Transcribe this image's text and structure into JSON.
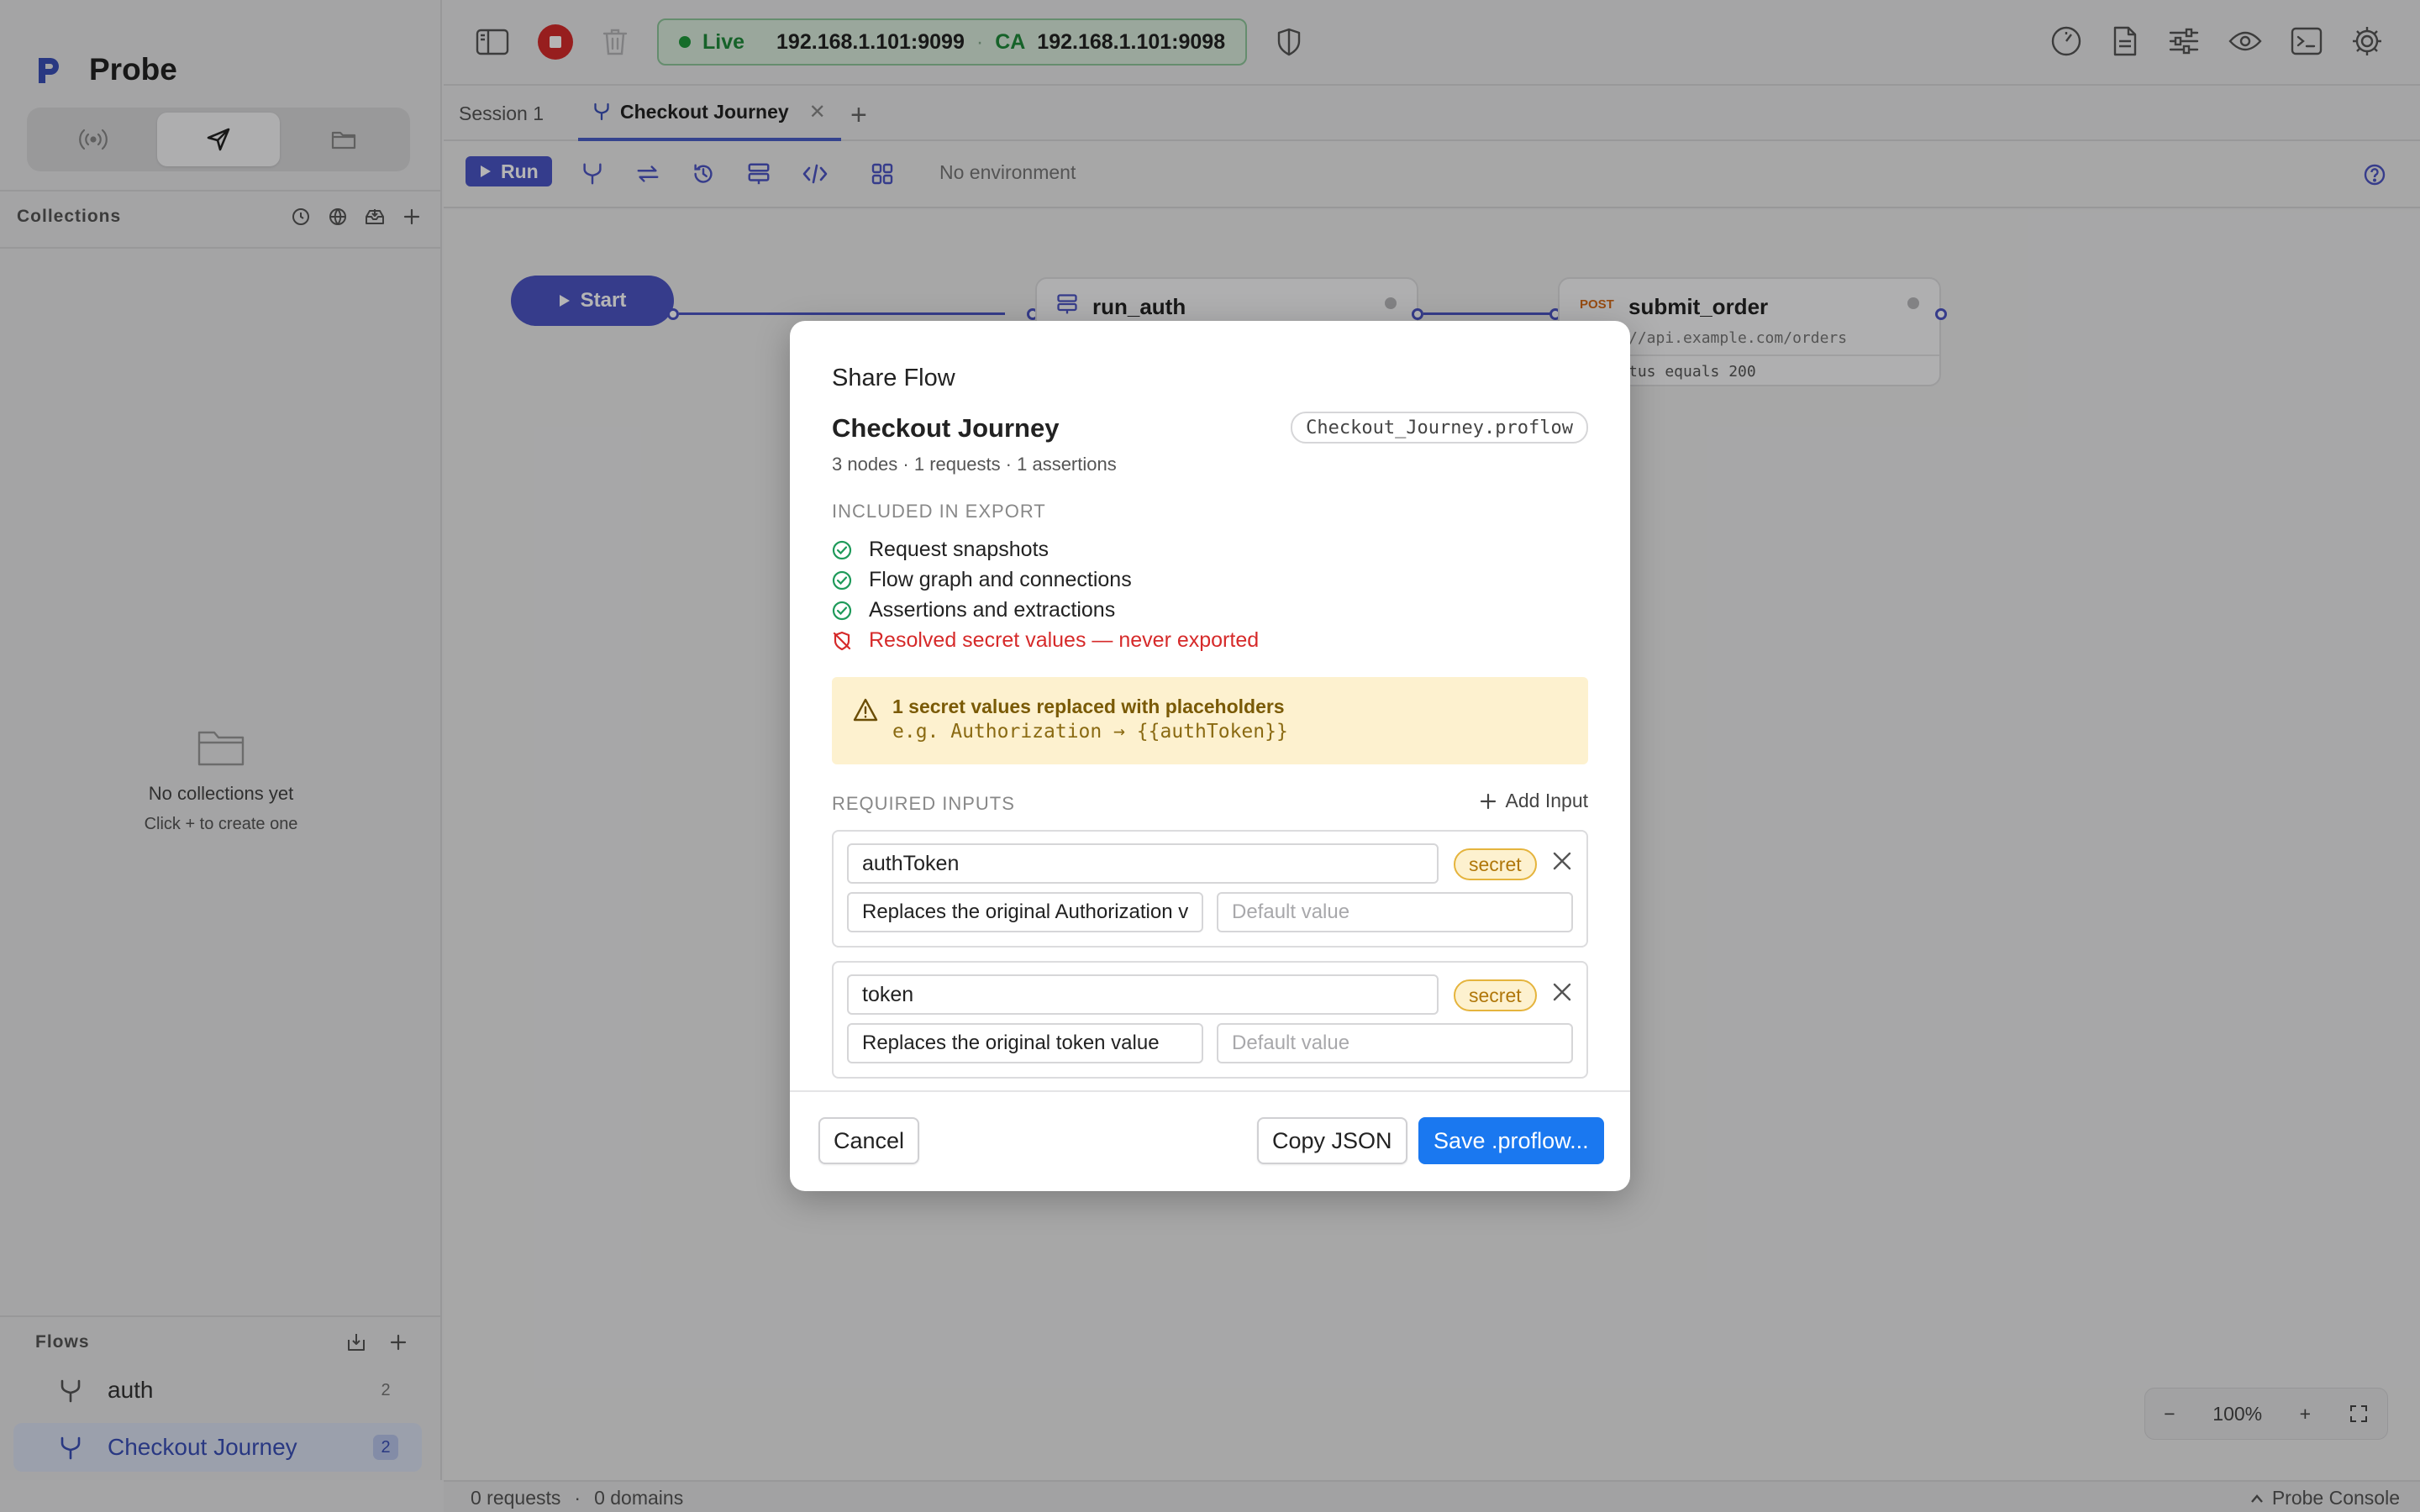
{
  "app": {
    "name": "Probe"
  },
  "sidebar": {
    "collections_title": "Collections",
    "empty_title": "No collections yet",
    "empty_sub": "Click + to create one",
    "flows_title": "Flows",
    "flows": [
      {
        "name": "auth",
        "count": "2"
      },
      {
        "name": "Checkout Journey",
        "count": "2"
      }
    ]
  },
  "topbar": {
    "live_label": "Live",
    "proxy_addr": "192.168.1.101:9099",
    "ca_label": "CA",
    "ca_addr": "192.168.1.101:9098"
  },
  "tabs": [
    {
      "label": "Session 1"
    },
    {
      "label": "Checkout Journey"
    }
  ],
  "toolbar": {
    "run_label": "Run",
    "environment": "No environment"
  },
  "canvas": {
    "start_label": "Start",
    "node1_title": "run_auth",
    "node2_method": "POST",
    "node2_title": "submit_order",
    "node2_url": "//api.example.com/orders",
    "node2_assert": "tus equals 200",
    "zoom": "100%"
  },
  "status": {
    "requests": "0 requests",
    "sep": "·",
    "domains": "0 domains",
    "console": "Probe Console"
  },
  "modal": {
    "title": "Share Flow",
    "flow_name": "Checkout Journey",
    "filename": "Checkout_Journey.proflow",
    "meta": "3 nodes · 1 requests · 1 assertions",
    "included_title": "INCLUDED IN EXPORT",
    "included": [
      "Request snapshots",
      "Flow graph and connections",
      "Assertions and extractions"
    ],
    "excluded": "Resolved secret values — never exported",
    "warning_title": "1 secret values replaced with placeholders",
    "warning_example": "e.g. Authorization → {{authToken}}",
    "required_title": "REQUIRED INPUTS",
    "add_input": "Add Input",
    "inputs": [
      {
        "name": "authToken",
        "badge": "secret",
        "description": "Replaces the original Authorization va",
        "default_placeholder": "Default value"
      },
      {
        "name": "token",
        "badge": "secret",
        "description": "Replaces the original token value",
        "default_placeholder": "Default value"
      }
    ],
    "cancel": "Cancel",
    "copy_json": "Copy JSON",
    "save": "Save .proflow..."
  },
  "colors": {
    "accent": "#4d55c4",
    "primary_button": "#1a78f0",
    "live_green": "#1f8a3a",
    "stop_red": "#d52b2b",
    "danger": "#d62a2a",
    "warning_bg": "#fdf1cf"
  }
}
